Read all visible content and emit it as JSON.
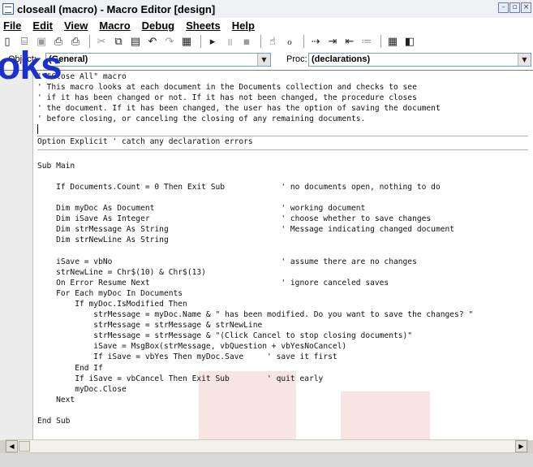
{
  "window": {
    "title": "closeall (macro) - Macro Editor [design]"
  },
  "menu": [
    "File",
    "Edit",
    "View",
    "Macro",
    "Debug",
    "Sheets",
    "Help"
  ],
  "toolbar_icons": [
    "new-doc-icon",
    "open-icon",
    "save-icon",
    "print-preview-icon",
    "print-icon",
    "cut-icon",
    "copy-icon",
    "paste-icon",
    "undo-icon",
    "redo-icon",
    "dialog-editor-icon",
    "run-icon",
    "pause-icon",
    "stop-icon",
    "step-icon",
    "watch-icon",
    "step-into-icon",
    "indent-icon",
    "outdent-icon",
    "comment-icon",
    "object-browser-icon",
    "references-icon"
  ],
  "watermark": "oks",
  "objbar": {
    "object_label": "Object:",
    "object_value": "(General)",
    "proc_label": "Proc:",
    "proc_value": "(declarations)"
  },
  "code": [
    "' \"Close All\" macro",
    "' This macro looks at each document in the Documents collection and checks to see",
    "' if it has been changed or not. If it has not been changed, the procedure closes",
    "' the document. If it has been changed, the user has the option of saving the document",
    "' before closing, or canceling the closing of any remaining documents.",
    "",
    "Option Explicit ' catch any declaration errors",
    "",
    "Sub Main",
    "",
    "    If Documents.Count = 0 Then Exit Sub            ' no documents open, nothing to do",
    "",
    "    Dim myDoc As Document                           ' working document",
    "    Dim iSave As Integer                            ' choose whether to save changes",
    "    Dim strMessage As String                        ' Message indicating changed document",
    "    Dim strNewLine As String",
    "",
    "    iSave = vbNo                                    ' assume there are no changes",
    "    strNewLine = Chr$(10) & Chr$(13)",
    "    On Error Resume Next                            ' ignore canceled saves",
    "    For Each myDoc In Documents",
    "        If myDoc.IsModified Then",
    "            strMessage = myDoc.Name & \" has been modified. Do you want to save the changes? \"",
    "            strMessage = strMessage & strNewLine",
    "            strMessage = strMessage & \"(Click Cancel to stop closing documents)\"",
    "            iSave = MsgBox(strMessage, vbQuestion + vbYesNoCancel)",
    "            If iSave = vbYes Then myDoc.Save     ' save it first",
    "        End If",
    "        If iSave = vbCancel Then Exit Sub        ' quit early",
    "        myDoc.Close",
    "    Next",
    "",
    "End Sub"
  ]
}
